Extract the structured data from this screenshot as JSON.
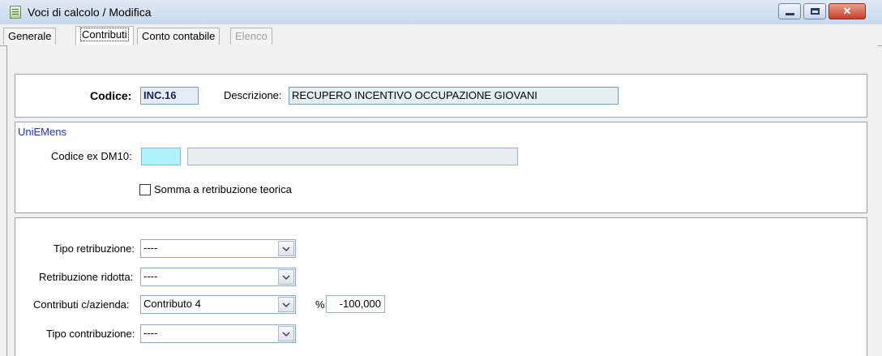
{
  "window": {
    "title": "Voci di calcolo / Modifica",
    "close_glyph": "✕"
  },
  "tabs": [
    {
      "label": "Generale",
      "state": "normal"
    },
    {
      "label": "Contributi",
      "state": "active"
    },
    {
      "label": "Conto contabile",
      "state": "normal"
    },
    {
      "label": "Elenco",
      "state": "disabled"
    }
  ],
  "header": {
    "codice_label": "Codice:",
    "codice_value": "INC.16",
    "descrizione_label": "Descrizione:",
    "descrizione_value": "RECUPERO INCENTIVO OCCUPAZIONE GIOVANI"
  },
  "uniemens": {
    "title": "UniEMens",
    "codice_ex_label": "Codice ex DM10:",
    "codice_ex_value": "",
    "codice_ex_desc": "",
    "somma_label": "Somma a retribuzione teorica",
    "somma_checked": false
  },
  "retribuzione": {
    "tipo_label": "Tipo retribuzione:",
    "tipo_value": "----",
    "ridotta_label": "Retribuzione ridotta:",
    "ridotta_value": "----",
    "contributi_label": "Contributi c/azienda:",
    "contributi_value": "Contributo 4",
    "percent_label": "%:",
    "percent_value": "-100,000",
    "tipo_contrib_label": "Tipo contribuzione:",
    "tipo_contrib_value": "----"
  }
}
